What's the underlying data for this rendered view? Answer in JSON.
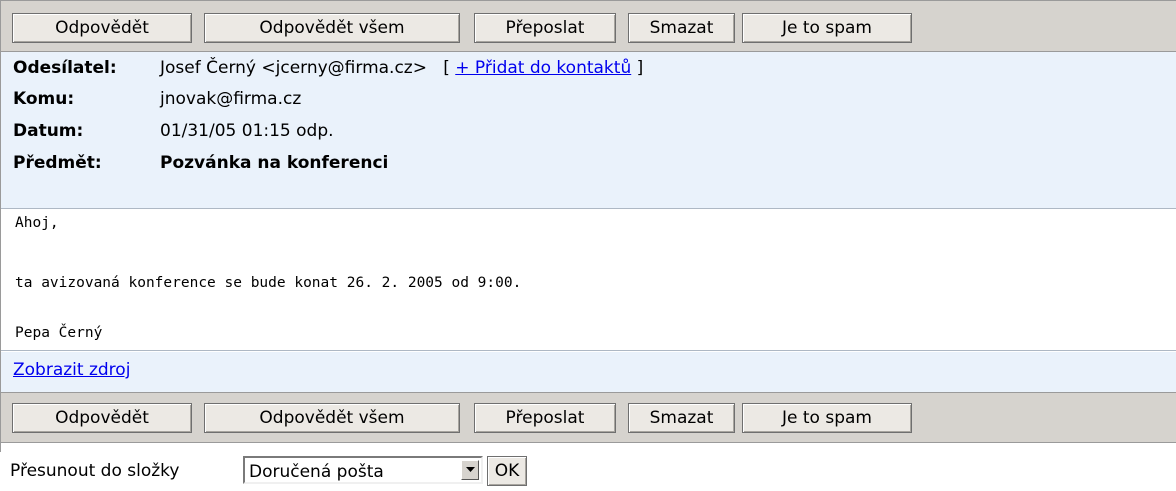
{
  "toolbar": {
    "reply": "Odpovědět",
    "reply_all": "Odpovědět všem",
    "forward": "Přeposlat",
    "delete": "Smazat",
    "spam": "Je to spam"
  },
  "headers": {
    "from_label": "Odesílatel:",
    "from_value": "Josef Černý <jcerny@firma.cz>",
    "bracket_open": "[",
    "add_contact": "+ Přidat do kontaktů",
    "bracket_close": "]",
    "to_label": "Komu:",
    "to_value": "jnovak@firma.cz",
    "date_label": "Datum:",
    "date_value": "01/31/05 01:15 odp.",
    "subject_label": "Předmět:",
    "subject_value": "Pozvánka na konferenci"
  },
  "body": {
    "line1": "Ahoj,",
    "line2": "ta avizovaná konference se bude konat 26. 2. 2005 od 9:00.",
    "line3": "Pepa Černý"
  },
  "view_source": "Zobrazit zdroj",
  "move": {
    "label": "Přesunout do složky",
    "selected_folder": "Doručená pošta",
    "ok": "OK"
  }
}
